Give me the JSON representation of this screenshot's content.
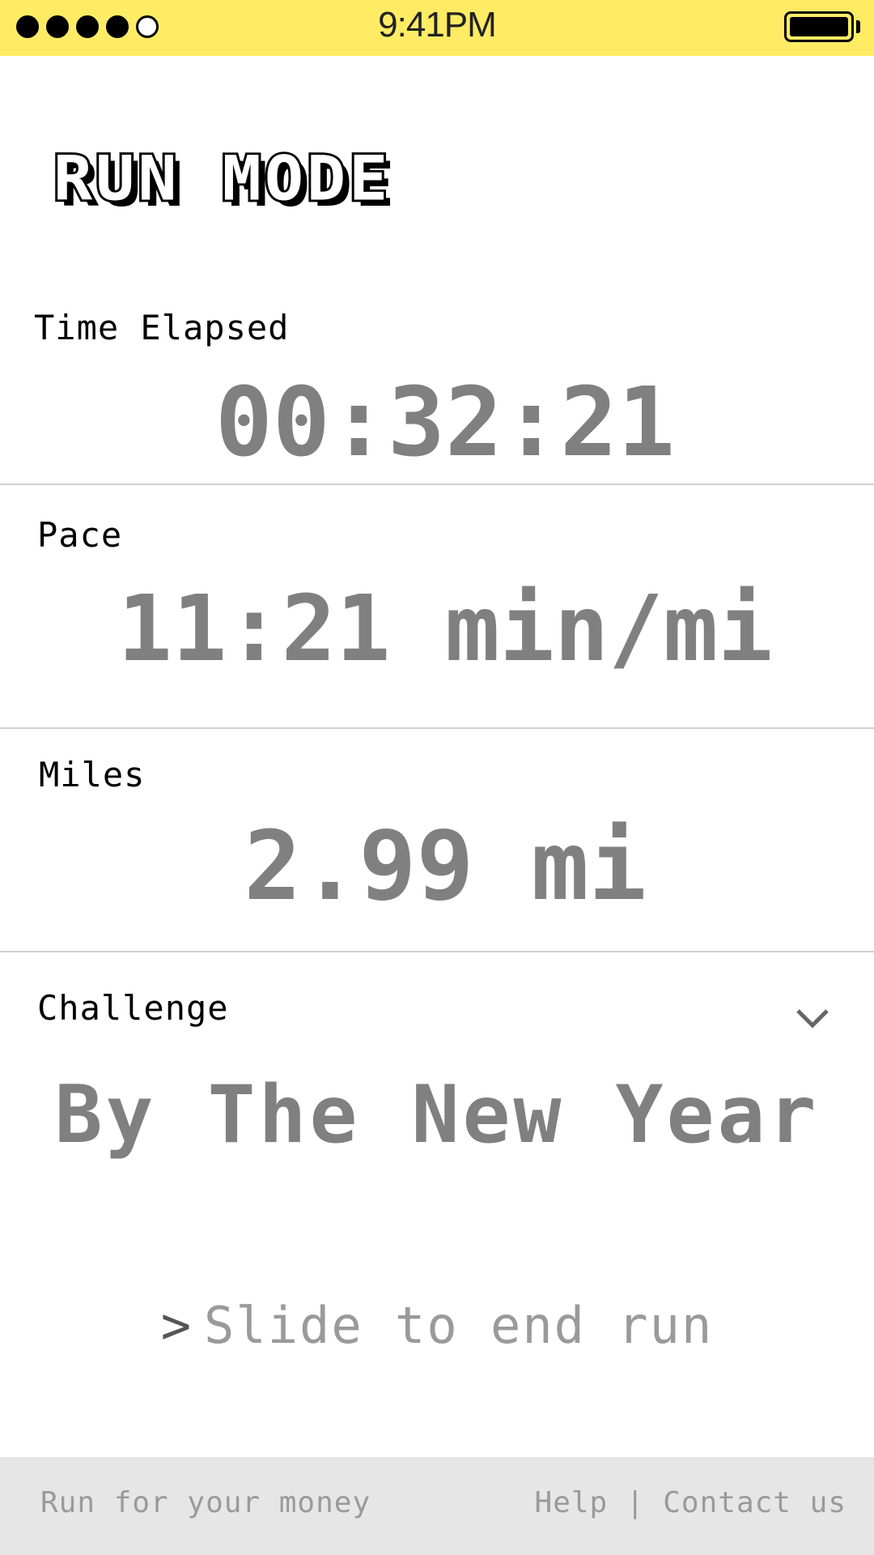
{
  "status_bar": {
    "time": "9:41PM",
    "signal_dots_filled": 4,
    "signal_dots_total": 5,
    "battery_icon": "battery-full-icon",
    "background_color": "#ffec64"
  },
  "header": {
    "logo_text": "RUN MODE"
  },
  "stats": {
    "time_elapsed": {
      "label": "Time Elapsed",
      "value": "00:32:21"
    },
    "pace": {
      "label": "Pace",
      "value": "11:21 min/mi"
    },
    "miles": {
      "label": "Miles",
      "value": "2.99 mi"
    },
    "challenge": {
      "label": "Challenge",
      "value": "By The New Year",
      "expand_icon": "chevron-down-icon"
    }
  },
  "slider": {
    "arrow": ">",
    "label": "Slide to end run"
  },
  "footer": {
    "tagline": "Run for your money",
    "links": "Help | Contact us"
  },
  "colors": {
    "value_gray": "#808080",
    "muted_gray": "#9a9a9a",
    "footer_bg": "#e6e6e6"
  }
}
